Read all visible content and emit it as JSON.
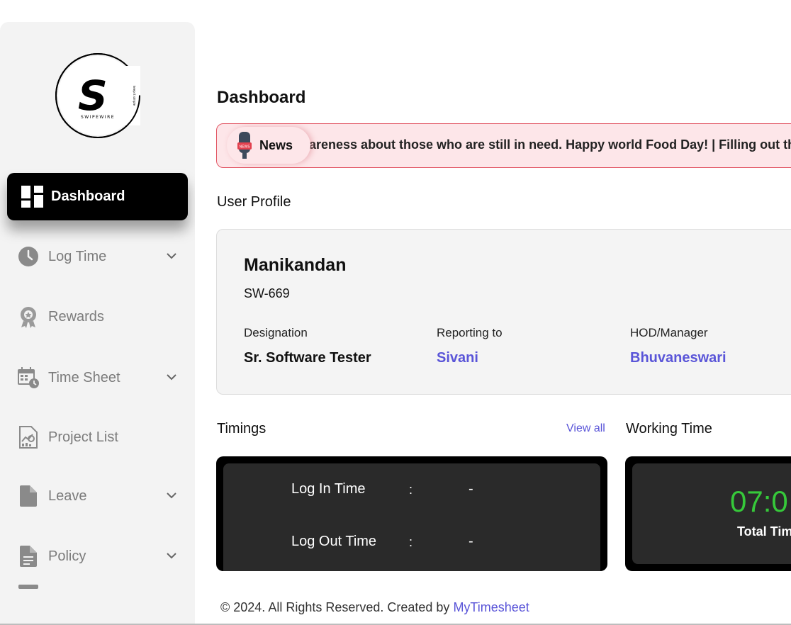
{
  "brand": {
    "logo_text": "SWIPEWIRE",
    "logo_tagline": "keep it simple"
  },
  "sidebar": {
    "active": {
      "label": "Dashboard",
      "icon": "dashboard-icon"
    },
    "items": [
      {
        "label": "Log Time",
        "icon": "clock-icon",
        "has_chevron": true
      },
      {
        "label": "Rewards",
        "icon": "award-icon",
        "has_chevron": false
      },
      {
        "label": "Time Sheet",
        "icon": "calendar-clock-icon",
        "has_chevron": true
      },
      {
        "label": "Project List",
        "icon": "project-report-icon",
        "has_chevron": false
      },
      {
        "label": "Leave",
        "icon": "document-icon",
        "has_chevron": true
      },
      {
        "label": "Policy",
        "icon": "policy-document-icon",
        "has_chevron": true
      }
    ]
  },
  "page": {
    "title": "Dashboard"
  },
  "news": {
    "label": "News",
    "ticker": "areness about those who are still in need. Happy world Food Day! | Filling out the"
  },
  "profile": {
    "section_title": "User Profile",
    "name": "Manikandan",
    "employee_id": "SW-669",
    "designation_label": "Designation",
    "designation": "Sr. Software Tester",
    "reporting_label": "Reporting to",
    "reporting_to": "Sivani",
    "hod_label": "HOD/Manager",
    "hod": "Bhuvaneswari"
  },
  "timings": {
    "section_title": "Timings",
    "view_all": "View all",
    "login_label": "Log In Time",
    "login_sep": ":",
    "login_value": "-",
    "logout_label": "Log Out Time",
    "logout_sep": ":",
    "logout_value": "-"
  },
  "working_time": {
    "section_title": "Working Time",
    "value": "07:0",
    "label": "Total Tim"
  },
  "footer": {
    "text": "© 2024. All Rights Reserved. Created by ",
    "link": "MyTimesheet"
  },
  "colors": {
    "accent": "#5a55d8",
    "green": "#36c83a",
    "news_bg": "#fde6e9",
    "news_border": "#e25563"
  }
}
